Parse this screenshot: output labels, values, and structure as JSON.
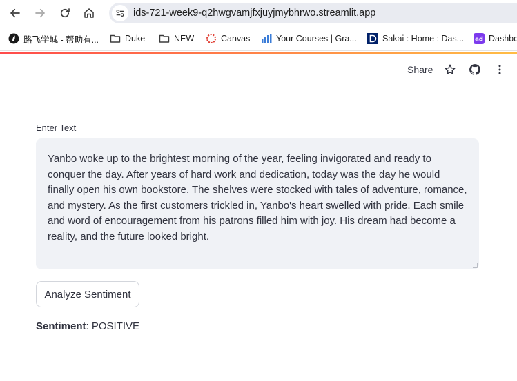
{
  "browser": {
    "url": "ids-721-week9-q2hwgvamjfxjuyjmybhrwo.streamlit.app",
    "bookmarks": [
      {
        "label": "路飞学城 - 帮助有...",
        "icon": "rocket-favicon-icon"
      },
      {
        "label": "Duke",
        "icon": "folder-icon"
      },
      {
        "label": "NEW",
        "icon": "folder-icon"
      },
      {
        "label": "Canvas",
        "icon": "canvas-favicon-icon"
      },
      {
        "label": "Your Courses | Gra...",
        "icon": "bar-chart-favicon-icon"
      },
      {
        "label": "Sakai : Home : Das...",
        "icon": "duke-d-favicon-icon"
      },
      {
        "label": "Dashbo",
        "icon": "ed-favicon-icon"
      }
    ]
  },
  "header": {
    "share_label": "Share"
  },
  "main": {
    "input_label": "Enter Text",
    "input_value": "Yanbo woke up to the brightest morning of the year, feeling invigorated and ready to conquer the day. After years of hard work and dedication, today was the day he would finally open his own bookstore. The shelves were stocked with tales of adventure, romance, and mystery. As the first customers trickled in, Yanbo's heart swelled with pride. Each smile and word of encouragement from his patrons filled him with joy. His dream had become a reality, and the future looked bright.",
    "button_label": "Analyze Sentiment",
    "result_key": "Sentiment",
    "result_separator": ": ",
    "result_value": "POSITIVE"
  },
  "colors": {
    "accent_start": "#ff4b4b",
    "accent_end": "#ffbd45",
    "input_bg": "#f0f2f6",
    "text": "#31333f"
  }
}
